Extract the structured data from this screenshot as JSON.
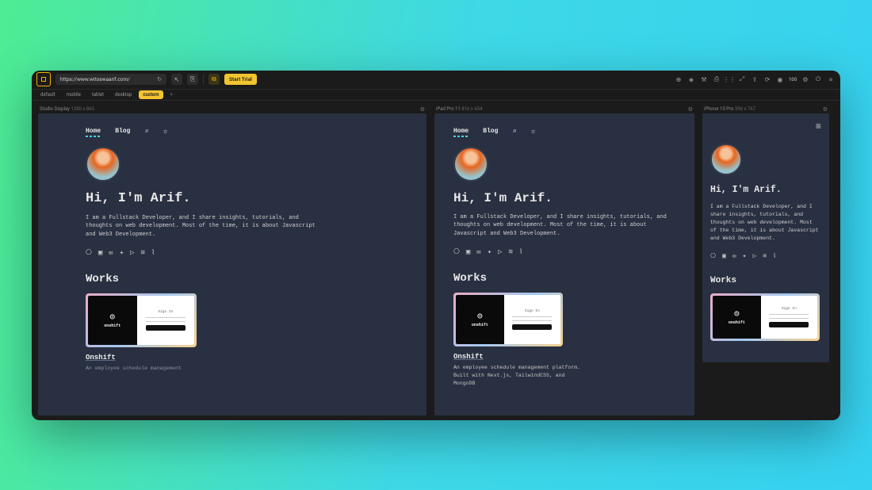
{
  "toolbar": {
    "url": "https://www.witoswaarif.com/",
    "trial_label": "Start Trial",
    "right_badge_100": "100"
  },
  "tabs": [
    "default",
    "mobile",
    "tablet",
    "desktop",
    "custom"
  ],
  "active_tab_index": 4,
  "viewports": [
    {
      "label": "Studio Display",
      "dim": "1280 x 865"
    },
    {
      "label": "iPad Pro 11",
      "dim": "816 x 654"
    },
    {
      "label": "iPhone 13 Pro",
      "dim": "396 x 767"
    }
  ],
  "site": {
    "nav": {
      "home": "Home",
      "blog": "Blog"
    },
    "hero": "Hi, I'm Arif.",
    "bio": "I am a Fullstack Developer, and I share insights, tutorials, and thoughts on web development. Most of the time, it is about Javascript and Web3 Development.",
    "works_heading": "Works",
    "work_title": "Onshift",
    "work_brand": "onshift",
    "work_signin": "Sign In",
    "work_desc_full": "An employee schedule management platform. Built with Next.js, TailwindCSS, and MongoDB",
    "work_desc_clip": "An employee schedule management"
  }
}
